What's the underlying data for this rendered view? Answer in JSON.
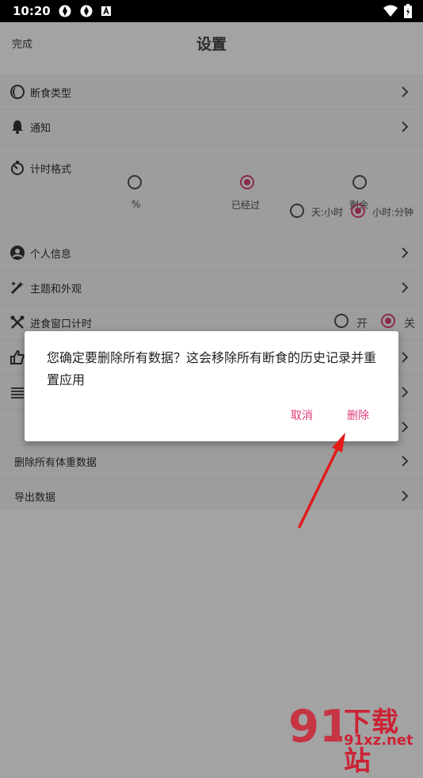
{
  "status_bar": {
    "time": "10:20"
  },
  "header": {
    "done_label": "完成",
    "title": "设置"
  },
  "settings": {
    "fasting_type": "断食类型",
    "notifications": "通知",
    "timer_format": {
      "label": "计时格式",
      "options": [
        "%",
        "已经过",
        "剩余"
      ],
      "selected": "已经过",
      "sub_options": [
        "天:小时",
        "小时:分钟"
      ],
      "sub_selected": "小时:分钟"
    },
    "personal_info": "个人信息",
    "theme": "主题和外观",
    "eating_window": {
      "label": "进食窗口计时",
      "on": "开",
      "off": "关",
      "selected": "关"
    },
    "delete_weight": "删除所有体重数据",
    "export": "导出数据"
  },
  "dialog": {
    "message": "您确定要删除所有数据？这会移除所有断食的历史记录并重置应用",
    "cancel": "取消",
    "delete": "删除"
  },
  "watermark": {
    "brand": "下载站",
    "domain": "91xz.net"
  },
  "colors": {
    "accent": "#e03b7c",
    "annotation_arrow": "#e31b1b"
  }
}
